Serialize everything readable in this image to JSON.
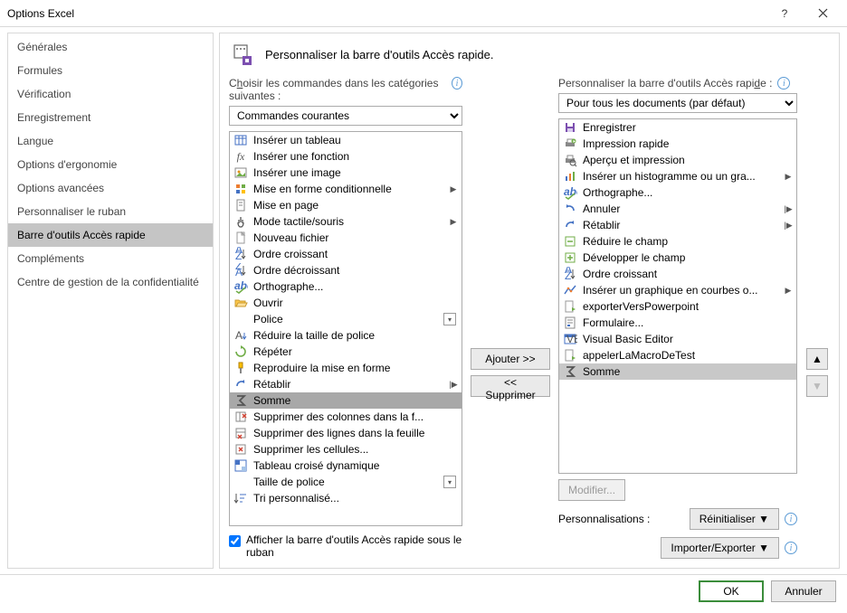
{
  "window": {
    "title": "Options Excel"
  },
  "sidebar": {
    "items": [
      {
        "label": "Générales"
      },
      {
        "label": "Formules"
      },
      {
        "label": "Vérification"
      },
      {
        "label": "Enregistrement"
      },
      {
        "label": "Langue"
      },
      {
        "label": "Options d'ergonomie"
      },
      {
        "label": "Options avancées"
      },
      {
        "label": "Personnaliser le ruban"
      },
      {
        "label": "Barre d'outils Accès rapide",
        "selected": true
      },
      {
        "label": "Compléments"
      },
      {
        "label": "Centre de gestion de la confidentialité"
      }
    ]
  },
  "content": {
    "header": "Personnaliser la barre d'outils Accès rapide.",
    "left_label_pre": "C",
    "left_label_u": "h",
    "left_label_post": "oisir les commandes dans les catégories suivantes :",
    "left_select": "Commandes courantes",
    "right_label": "Personnaliser la barre d'outils Accès rapi",
    "right_label_u": "d",
    "right_label_post": "e :",
    "right_select": "Pour tous les documents (par défaut)",
    "add_btn_pre": "A",
    "add_btn_u": "j",
    "add_btn_post": "outer >>",
    "remove_btn_pre": "<< ",
    "remove_btn_u": "S",
    "remove_btn_post": "upprimer",
    "modify_btn_pre": "",
    "modify_btn_u": "M",
    "modify_btn_post": "odifier...",
    "customizations_label": "Personnalisations :",
    "reset_btn_pre": "R",
    "reset_btn_u": "é",
    "reset_btn_post": "initialiser",
    "import_btn_pre": "Im",
    "import_btn_u": "p",
    "import_btn_post": "orter/Exporter",
    "checkbox_label": "Afficher la barre d'outils Accès rapide sous le ruban",
    "checkbox_checked": true
  },
  "left_list": [
    {
      "icon": "table",
      "label": "Insérer un tableau"
    },
    {
      "icon": "fx",
      "label": "Insérer une fonction"
    },
    {
      "icon": "image",
      "label": "Insérer une image"
    },
    {
      "icon": "cond",
      "label": "Mise en forme conditionnelle",
      "submenu": true
    },
    {
      "icon": "page",
      "label": "Mise en page"
    },
    {
      "icon": "touch",
      "label": "Mode tactile/souris",
      "submenu": true
    },
    {
      "icon": "new",
      "label": "Nouveau fichier"
    },
    {
      "icon": "sort-asc",
      "label": "Ordre croissant"
    },
    {
      "icon": "sort-desc",
      "label": "Ordre décroissant"
    },
    {
      "icon": "spell",
      "label": "Orthographe..."
    },
    {
      "icon": "open",
      "label": "Ouvrir"
    },
    {
      "icon": "font",
      "label": "Police",
      "dropdown": true
    },
    {
      "icon": "font-dec",
      "label": "Réduire la taille de police"
    },
    {
      "icon": "repeat",
      "label": "Répéter"
    },
    {
      "icon": "brush",
      "label": "Reproduire la mise en forme"
    },
    {
      "icon": "redo",
      "label": "Rétablir",
      "split": true
    },
    {
      "icon": "sum",
      "label": "Somme",
      "selected": true
    },
    {
      "icon": "del-col",
      "label": "Supprimer des colonnes dans la f..."
    },
    {
      "icon": "del-row",
      "label": "Supprimer des lignes dans la feuille"
    },
    {
      "icon": "del-cell",
      "label": "Supprimer les cellules..."
    },
    {
      "icon": "pivot",
      "label": "Tableau croisé dynamique"
    },
    {
      "icon": "font-size",
      "label": "Taille de police",
      "dropdown": true
    },
    {
      "icon": "custom-sort",
      "label": "Tri personnalisé..."
    }
  ],
  "right_list": [
    {
      "icon": "save",
      "label": "Enregistrer"
    },
    {
      "icon": "quick-print",
      "label": "Impression rapide"
    },
    {
      "icon": "preview",
      "label": "Aperçu et impression"
    },
    {
      "icon": "histogram",
      "label": "Insérer un histogramme ou un gra...",
      "submenu": true
    },
    {
      "icon": "spell",
      "label": "Orthographe..."
    },
    {
      "icon": "undo",
      "label": "Annuler",
      "split": true
    },
    {
      "icon": "redo",
      "label": "Rétablir",
      "split": true
    },
    {
      "icon": "collapse",
      "label": "Réduire le champ"
    },
    {
      "icon": "expand",
      "label": "Développer le champ"
    },
    {
      "icon": "sort-asc",
      "label": "Ordre croissant"
    },
    {
      "icon": "line-chart",
      "label": "Insérer un graphique en courbes o...",
      "submenu": true
    },
    {
      "icon": "macro",
      "label": "exporterVersPowerpoint"
    },
    {
      "icon": "form",
      "label": "Formulaire..."
    },
    {
      "icon": "vbe",
      "label": "Visual Basic Editor"
    },
    {
      "icon": "macro",
      "label": "appelerLaMacroDeTest"
    },
    {
      "icon": "sum",
      "label": "Somme",
      "selected": true
    }
  ],
  "footer": {
    "ok": "OK",
    "cancel": "Annuler"
  }
}
